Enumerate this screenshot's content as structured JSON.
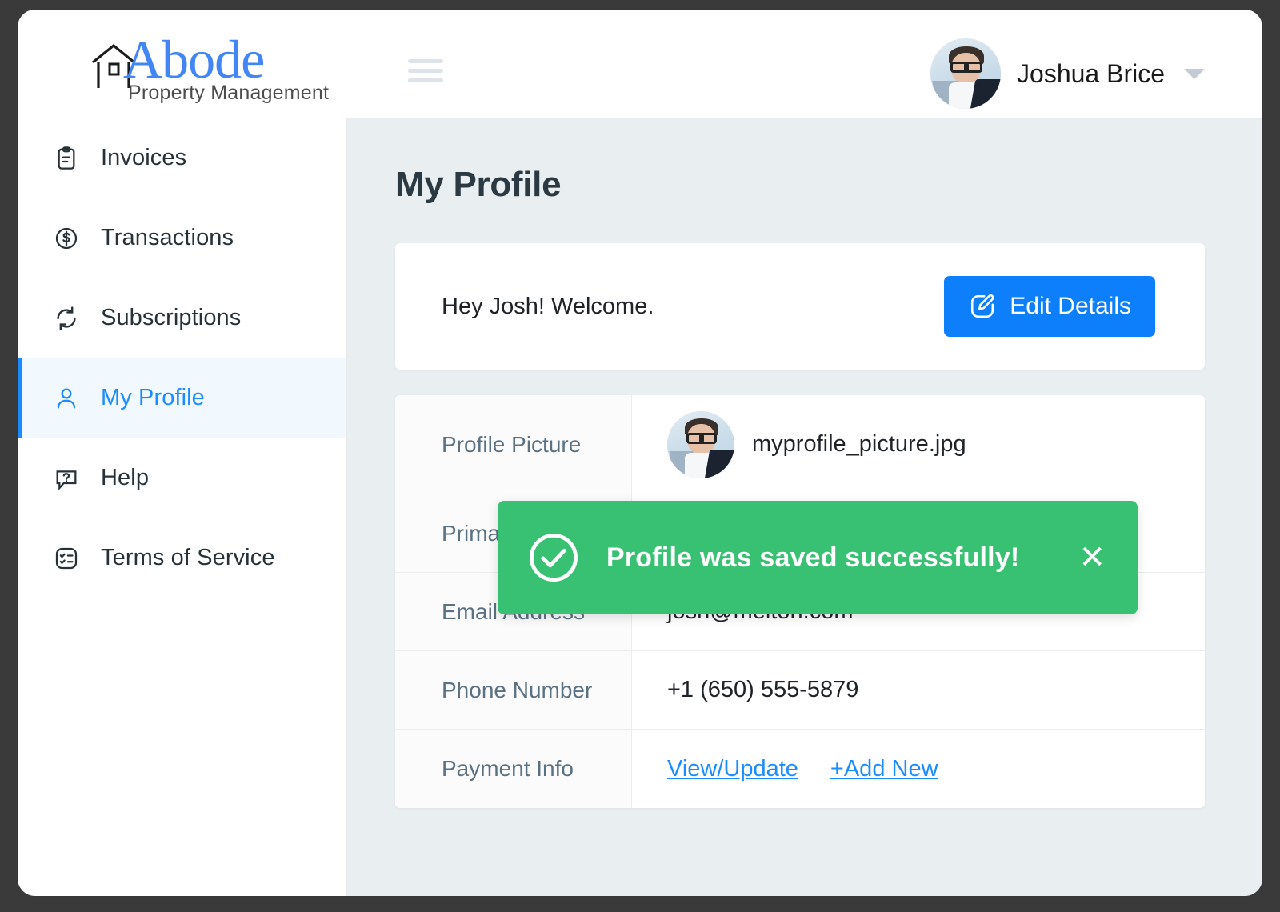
{
  "brand": {
    "name": "Abode",
    "tagline": "Property Management",
    "house_icon": "house-icon"
  },
  "topbar": {
    "menu_icon": "hamburger-menu-icon",
    "user_name": "Joshua Brice",
    "user_avatar_icon": "user-avatar-photo",
    "caret_icon": "chevron-down-icon"
  },
  "sidebar": {
    "items": [
      {
        "label": "Invoices",
        "icon": "clipboard-icon",
        "active": false
      },
      {
        "label": "Transactions",
        "icon": "dollar-circle-icon",
        "active": false
      },
      {
        "label": "Subscriptions",
        "icon": "refresh-sync-icon",
        "active": false
      },
      {
        "label": "My Profile",
        "icon": "user-icon",
        "active": true
      },
      {
        "label": "Help",
        "icon": "question-speech-bubble-icon",
        "active": false
      },
      {
        "label": "Terms of Service",
        "icon": "checklist-icon",
        "active": false
      }
    ]
  },
  "main": {
    "page_title": "My Profile",
    "welcome": {
      "greeting": "Hey Josh! Welcome.",
      "edit_button_label": "Edit Details",
      "edit_button_icon": "pencil-edit-icon"
    },
    "info_rows": [
      {
        "label": "Profile Picture",
        "value": "myprofile_picture.jpg",
        "type": "image-file"
      },
      {
        "label": "Primary Contact",
        "value": "",
        "type": "text"
      },
      {
        "label": "Email Address",
        "value": "josh@melton.com",
        "type": "text"
      },
      {
        "label": "Phone Number",
        "value": "+1 (650) 555-5879",
        "type": "text"
      },
      {
        "label": "Payment Info",
        "value": "",
        "type": "links",
        "links": [
          "View/Update",
          "+Add New"
        ]
      }
    ]
  },
  "toast": {
    "message": "Profile was saved successfully!",
    "icon": "check-circle-icon",
    "close_icon": "close-x-icon",
    "color": "#38c172"
  },
  "colors": {
    "accent_blue": "#1a8cff",
    "button_blue": "#0d7ffa",
    "logo_blue": "#4285f4",
    "success_green": "#38c172",
    "content_bg": "#e9eef1",
    "label_text": "#5a7183"
  }
}
